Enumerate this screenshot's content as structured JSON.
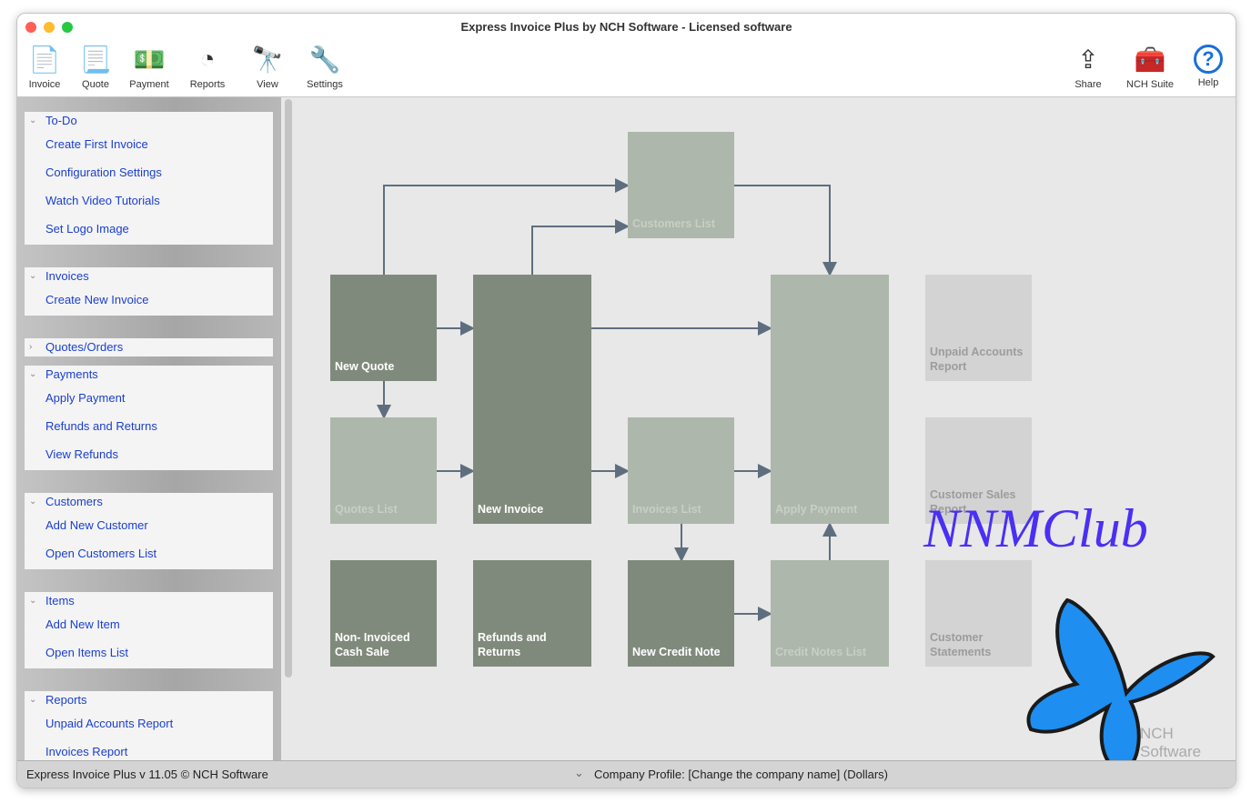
{
  "window": {
    "title": "Express Invoice Plus by NCH Software - Licensed software"
  },
  "toolbar": {
    "left": [
      {
        "label": "Invoice",
        "icon": "new-invoice-icon",
        "glyph": "📄"
      },
      {
        "label": "Quote",
        "icon": "new-quote-icon",
        "glyph": "📃"
      },
      {
        "label": "Payment",
        "icon": "payment-icon",
        "glyph": "💵"
      },
      {
        "label": "Reports",
        "icon": "reports-pie-icon",
        "glyph": "◔"
      },
      {
        "label": "View",
        "icon": "view-binoculars-icon",
        "glyph": "🔭"
      },
      {
        "label": "Settings",
        "icon": "settings-tools-icon",
        "glyph": "🔧"
      }
    ],
    "right": [
      {
        "label": "Share",
        "icon": "share-icon",
        "glyph": "⇪"
      },
      {
        "label": "NCH Suite",
        "icon": "nch-suite-icon",
        "glyph": "🧰"
      },
      {
        "label": "Help",
        "icon": "help-icon",
        "glyph": "?"
      }
    ]
  },
  "sidebar": {
    "sections": [
      {
        "title": "To-Do",
        "expanded": true,
        "items": [
          "Create First Invoice",
          "Configuration Settings",
          "Watch Video Tutorials",
          "Set Logo Image"
        ]
      },
      {
        "title": "Invoices",
        "expanded": true,
        "items": [
          "Create New Invoice"
        ]
      },
      {
        "title": "Quotes/Orders",
        "expanded": false,
        "items": []
      },
      {
        "title": "Payments",
        "expanded": true,
        "items": [
          "Apply Payment",
          "Refunds and Returns",
          "View Refunds"
        ]
      },
      {
        "title": "Customers",
        "expanded": true,
        "items": [
          "Add New Customer",
          "Open Customers List"
        ]
      },
      {
        "title": "Items",
        "expanded": true,
        "items": [
          "Add New Item",
          "Open Items List"
        ]
      },
      {
        "title": "Reports",
        "expanded": true,
        "items": [
          "Unpaid Accounts Report",
          "Invoices Report"
        ]
      }
    ]
  },
  "flow": {
    "boxes": [
      {
        "label": "Customers List",
        "style": "lt"
      },
      {
        "label": "New Quote",
        "style": "dk"
      },
      {
        "label": "New Invoice",
        "style": "dk"
      },
      {
        "label": "Apply Payment",
        "style": "lt"
      },
      {
        "label": "Unpaid Accounts Report",
        "style": "gy"
      },
      {
        "label": "Quotes List",
        "style": "lt"
      },
      {
        "label": "Invoices List",
        "style": "lt"
      },
      {
        "label": "Customer Sales Report",
        "style": "gy"
      },
      {
        "label": "Non- Invoiced Cash Sale",
        "style": "dk"
      },
      {
        "label": "Refunds and Returns",
        "style": "dk"
      },
      {
        "label": "New Credit Note",
        "style": "dk"
      },
      {
        "label": "Credit Notes List",
        "style": "lt"
      },
      {
        "label": "Customer Statements",
        "style": "gy"
      }
    ]
  },
  "watermark": {
    "text": "NNMClub",
    "nch_logo": "NCH Software"
  },
  "status": {
    "version": "Express Invoice Plus v 11.05 © NCH Software",
    "profile": "Company Profile: [Change the company name] (Dollars)"
  }
}
